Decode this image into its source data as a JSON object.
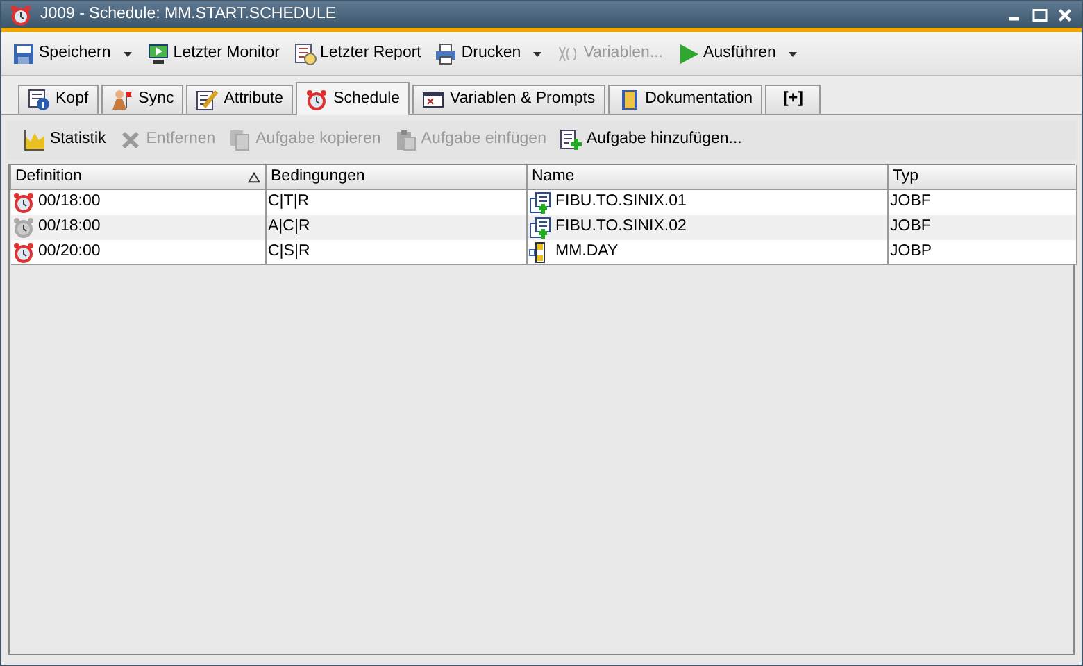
{
  "window": {
    "title": "J009 - Schedule: MM.START.SCHEDULE"
  },
  "toolbar": [
    {
      "label": "Speichern",
      "kind": "save",
      "disabled": false,
      "dropdown": true
    },
    {
      "label": "Letzter Monitor",
      "kind": "monitor",
      "disabled": false,
      "dropdown": false
    },
    {
      "label": "Letzter Report",
      "kind": "report",
      "disabled": false,
      "dropdown": false
    },
    {
      "label": "Drucken",
      "kind": "print",
      "disabled": false,
      "dropdown": true
    },
    {
      "label": "Variablen...",
      "kind": "vars",
      "disabled": true,
      "dropdown": false
    },
    {
      "label": "Ausführen",
      "kind": "run",
      "disabled": false,
      "dropdown": true
    }
  ],
  "tabs": [
    {
      "label": "Kopf",
      "kind": "info",
      "selected": false
    },
    {
      "label": "Sync",
      "kind": "sync",
      "selected": false
    },
    {
      "label": "Attribute",
      "kind": "attr",
      "selected": false
    },
    {
      "label": "Schedule",
      "kind": "clock",
      "selected": true
    },
    {
      "label": "Variablen & Prompts",
      "kind": "varwin",
      "selected": false
    },
    {
      "label": "Dokumentation",
      "kind": "doc",
      "selected": false
    },
    {
      "label": "[+]",
      "kind": "plain",
      "selected": false
    }
  ],
  "actions": [
    {
      "label": "Statistik",
      "kind": "chart",
      "disabled": false
    },
    {
      "label": "Entfernen",
      "kind": "remove",
      "disabled": true
    },
    {
      "label": "Aufgabe kopieren",
      "kind": "copy",
      "disabled": true
    },
    {
      "label": "Aufgabe einfügen",
      "kind": "paste",
      "disabled": true
    },
    {
      "label": "Aufgabe hinzufügen...",
      "kind": "add",
      "disabled": false
    }
  ],
  "table": {
    "columns": [
      {
        "label": "Definition",
        "sorted": true
      },
      {
        "label": "Bedingungen",
        "sorted": false
      },
      {
        "label": "Name",
        "sorted": false
      },
      {
        "label": "Typ",
        "sorted": false
      }
    ],
    "rows": [
      {
        "definition": "00/18:00",
        "active": true,
        "conditions": "C|T|R",
        "name": "FIBU.TO.SINIX.01",
        "kind": "job",
        "type": "JOBF"
      },
      {
        "definition": "00/18:00",
        "active": false,
        "conditions": "A|C|R",
        "name": "FIBU.TO.SINIX.02",
        "kind": "job",
        "type": "JOBF"
      },
      {
        "definition": "00/20:00",
        "active": true,
        "conditions": "C|S|R",
        "name": "MM.DAY",
        "kind": "workflow",
        "type": "JOBP"
      }
    ]
  }
}
